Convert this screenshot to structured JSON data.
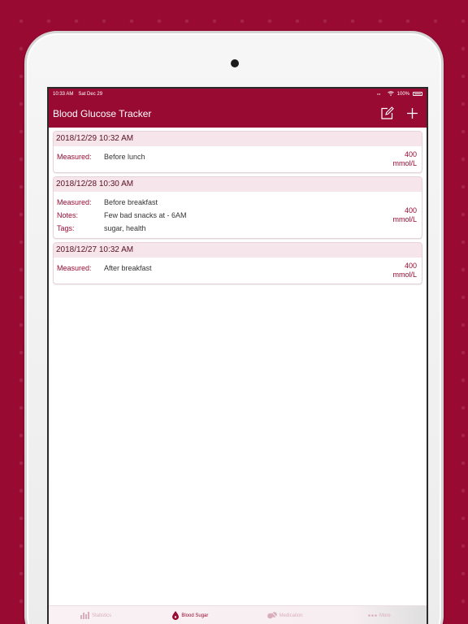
{
  "status": {
    "time": "10:33 AM",
    "date": "Sat Dec 29",
    "battery": "100%"
  },
  "nav": {
    "title": "Blood Glucose Tracker",
    "edit_icon": "edit-icon",
    "add_icon": "plus-icon"
  },
  "entries": [
    {
      "datetime": "2018/12/29 10:32 AM",
      "fields": [
        {
          "label": "Measured:",
          "value": "Before lunch"
        }
      ],
      "reading": "400",
      "unit": "mmol/L"
    },
    {
      "datetime": "2018/12/28 10:30 AM",
      "fields": [
        {
          "label": "Measured:",
          "value": "Before breakfast"
        },
        {
          "label": "Notes:",
          "value": "Few bad snacks at - 6AM"
        },
        {
          "label": "Tags:",
          "value": "sugar, health"
        }
      ],
      "reading": "400",
      "unit": "mmol/L"
    },
    {
      "datetime": "2018/12/27 10:32 AM",
      "fields": [
        {
          "label": "Measured:",
          "value": "After breakfast"
        }
      ],
      "reading": "400",
      "unit": "mmol/L"
    }
  ],
  "tabs": [
    {
      "label": "Statistics",
      "icon": "bar-chart-icon",
      "active": false
    },
    {
      "label": "Blood Sugar",
      "icon": "blood-drop-icon",
      "active": true
    },
    {
      "label": "Medication",
      "icon": "pills-icon",
      "active": false
    },
    {
      "label": "More",
      "icon": "more-dots-icon",
      "active": false
    }
  ],
  "colors": {
    "brand": "#990a33",
    "header_bg": "#f6e5ea",
    "inactive_tab": "#d8aebb"
  }
}
